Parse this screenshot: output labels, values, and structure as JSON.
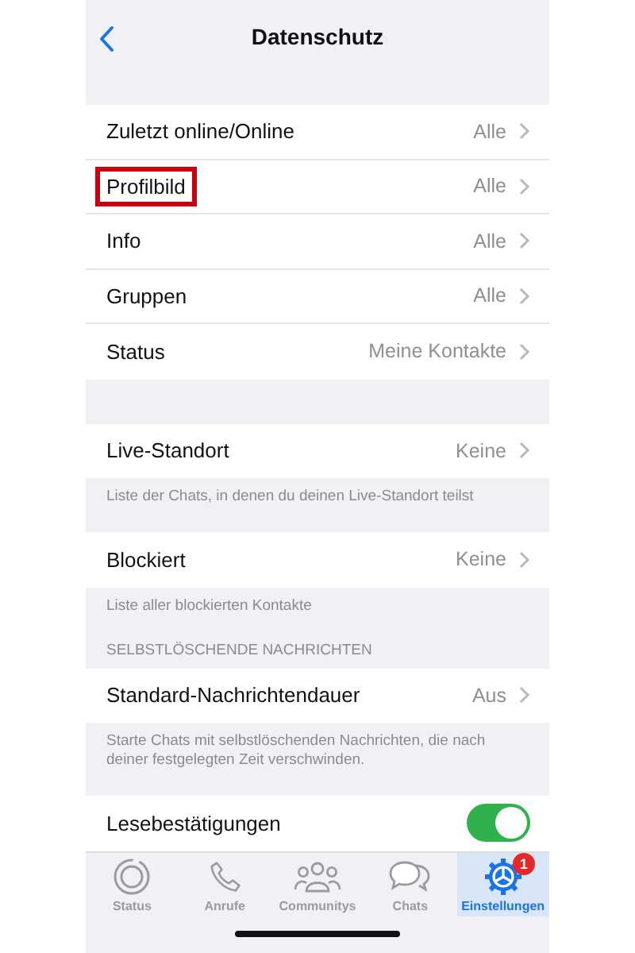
{
  "nav": {
    "title": "Datenschutz"
  },
  "sections": [
    {
      "rows": [
        {
          "kind": "link",
          "label": "Zuletzt online/Online",
          "value": "Alle",
          "highlighted": false
        },
        {
          "kind": "link",
          "label": "Profilbild",
          "value": "Alle",
          "highlighted": true
        },
        {
          "kind": "link",
          "label": "Info",
          "value": "Alle",
          "highlighted": false
        },
        {
          "kind": "link",
          "label": "Gruppen",
          "value": "Alle",
          "highlighted": false
        },
        {
          "kind": "link",
          "label": "Status",
          "value": "Meine Kontakte",
          "highlighted": false
        }
      ]
    },
    {
      "rows": [
        {
          "kind": "link",
          "label": "Live-Standort",
          "value": "Keine",
          "highlighted": false
        }
      ],
      "footer": "Liste der Chats, in denen du deinen Live-Standort teilst"
    },
    {
      "rows": [
        {
          "kind": "link",
          "label": "Blockiert",
          "value": "Keine",
          "highlighted": false
        }
      ],
      "footer": "Liste aller blockierten Kontakte"
    },
    {
      "header": "SELBSTLÖSCHENDE NACHRICHTEN",
      "rows": [
        {
          "kind": "link",
          "label": "Standard-Nachrichtendauer",
          "value": "Aus",
          "highlighted": false
        }
      ],
      "footer": "Starte Chats mit selbstlöschenden Nachrichten, die nach deiner festgelegten Zeit verschwinden."
    },
    {
      "rows": [
        {
          "kind": "toggle",
          "label": "Lesebestätigungen",
          "on": true,
          "highlighted": false
        }
      ]
    }
  ],
  "tabs": [
    {
      "kind": "status",
      "label": "Status",
      "selected": false
    },
    {
      "kind": "calls",
      "label": "Anrufe",
      "selected": false
    },
    {
      "kind": "communities",
      "label": "Communitys",
      "selected": false
    },
    {
      "kind": "chats",
      "label": "Chats",
      "selected": false
    },
    {
      "kind": "settings",
      "label": "Einstellungen",
      "selected": true,
      "badge": "1"
    }
  ]
}
